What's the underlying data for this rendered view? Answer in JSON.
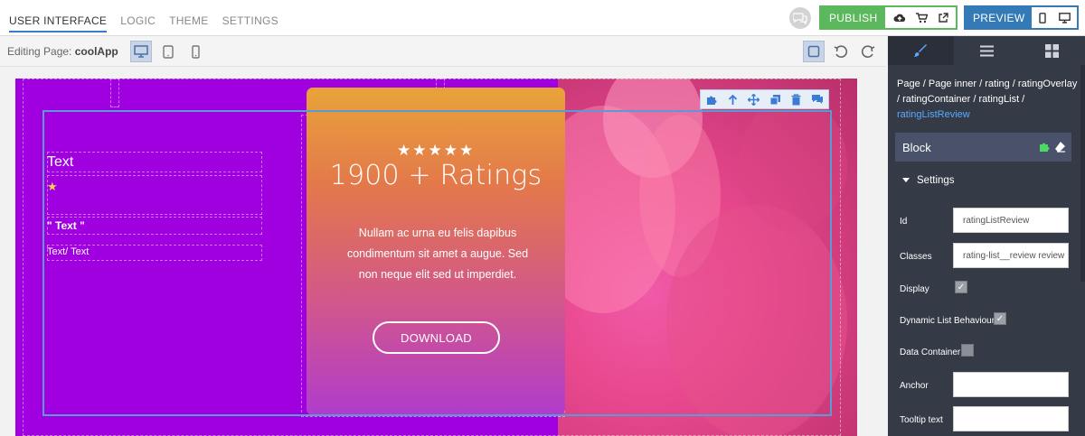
{
  "topbar": {
    "tabs": [
      {
        "label": "USER INTERFACE"
      },
      {
        "label": "LOGIC"
      },
      {
        "label": "THEME"
      },
      {
        "label": "SETTINGS"
      }
    ],
    "publish_label": "PUBLISH",
    "preview_label": "PREVIEW"
  },
  "editbar": {
    "editing_prefix": "Editing Page:",
    "page_name": "coolApp"
  },
  "canvas": {
    "left_title": "Text",
    "left_bold": "\" Text \"",
    "left_sub": "Text/ Text",
    "star_glyph": "★",
    "rating_stars": "★★★★★",
    "rating_title": "1900 + Ratings",
    "rating_body": "Nullam ac urna eu felis dapibus condimentum sit amet a augue. Sed non neque elit sed ut imperdiet.",
    "download_label": "DOWNLOAD"
  },
  "panel": {
    "breadcrumb_plain": "Page / Page inner / rating / ratingOverlay / ratingContainer / ratingList / ",
    "breadcrumb_current": "ratingListReview",
    "block_label": "Block",
    "settings_label": "Settings",
    "fields": {
      "id_label": "Id",
      "id_value": "ratingListReview",
      "classes_label": "Classes",
      "classes_value": "rating-list__review review",
      "display_label": "Display",
      "dynamic_label": "Dynamic List Behaviour",
      "data_container_label": "Data Container",
      "anchor_label": "Anchor",
      "anchor_value": "",
      "tooltip_label": "Tooltip text",
      "tooltip_value": ""
    }
  },
  "colors": {
    "canvas_purple": "#a000e0",
    "publish_green": "#5cb85c",
    "preview_blue": "#337ab7",
    "selection_blue": "#5b9bd5",
    "panel_dark": "#343a46"
  },
  "icons": {
    "chat": "chat-icon",
    "cloud_upload": "cloud-upload-icon",
    "cart": "cart-icon",
    "external": "external-link-icon",
    "phone": "phone-icon",
    "monitor": "monitor-icon",
    "tablet": "tablet-icon",
    "undo": "undo-icon",
    "redo": "redo-icon",
    "brush": "brush-icon",
    "menu": "menu-icon",
    "grid": "grid-icon"
  }
}
